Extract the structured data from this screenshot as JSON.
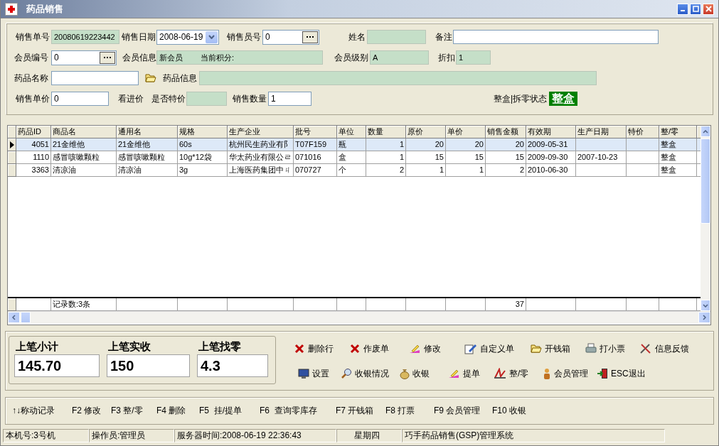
{
  "window": {
    "title": "药品销售"
  },
  "form": {
    "rows": [
      [
        {
          "label": "销售单号",
          "kind": "readonly",
          "value": "20080619223442"
        },
        {
          "label": "销售日期",
          "kind": "date",
          "value": "2008-06-19"
        },
        {
          "label": "销售员号",
          "kind": "lookup",
          "value": "0"
        },
        {
          "label": "姓名",
          "kind": "readonly"
        },
        {
          "label": "备注",
          "kind": "input"
        }
      ],
      [
        {
          "label": "会员编号",
          "kind": "lookup",
          "value": "0"
        },
        {
          "label": "会员信息",
          "kind": "readonly",
          "value": "新会员　　 当前积分:"
        },
        {
          "label": "会员级别",
          "kind": "readonly",
          "value": "A"
        },
        {
          "label": "折扣",
          "kind": "readonly",
          "value": "1"
        }
      ],
      [
        {
          "label": "药品名称",
          "kind": "input"
        },
        {
          "kind": "browse"
        },
        {
          "label": "药品信息",
          "kind": "readonly"
        }
      ],
      [
        {
          "label": "销售单价",
          "kind": "input",
          "value": "0"
        },
        {
          "label": "看进价",
          "kind": "text"
        },
        {
          "label": "是否特价",
          "kind": "readonly"
        },
        {
          "label": "销售数量",
          "kind": "input",
          "value": "1"
        },
        {
          "label": "整盒|拆零状态",
          "kind": "badge",
          "text": "整盒"
        }
      ]
    ]
  },
  "grid": {
    "columns": [
      "药品ID",
      "商品名",
      "通用名",
      "规格",
      "生产企业",
      "批号",
      "单位",
      "数量",
      "原价",
      "单价",
      "销售金额",
      "有效期",
      "生产日期",
      "特价",
      "整/零"
    ],
    "rows": [
      {
        "selected": true,
        "cells": [
          "4051",
          "21金维他",
          "21金维他",
          "60s",
          "杭州民生药业有阝",
          "T07F159",
          "瓶",
          "1",
          "20",
          "20",
          "20",
          "2009-05-31",
          null,
          null,
          "整盒"
        ]
      },
      {
        "selected": false,
        "cells": [
          "1110",
          "感冒咳嗽颗粒",
          "感冒咳嗽颗粒",
          "10g*12袋",
          "华太药业有限公ㄹ",
          "071016",
          "盒",
          "1",
          "15",
          "15",
          "15",
          "2009-09-30",
          "2007-10-23",
          null,
          "整盒"
        ]
      },
      {
        "selected": false,
        "cells": [
          "3363",
          "清凉油",
          "清凉油",
          "3g",
          "上海医药集团中ㄐ",
          "070727",
          "个",
          "2",
          "1",
          "1",
          "2",
          "2010-06-30",
          null,
          null,
          "整盒"
        ]
      }
    ],
    "footer": {
      "count": "记录数:3条",
      "total": "37"
    }
  },
  "totals": [
    {
      "label": "上笔小计",
      "value": "145.70"
    },
    {
      "label": "上笔实收",
      "value": "150"
    },
    {
      "label": "上笔找零",
      "value": "4.3"
    }
  ],
  "actions": [
    [
      "删除行",
      "作废单",
      "修改",
      "自定义单",
      "开钱箱",
      "打小票",
      "信息反馈"
    ],
    [
      "设置",
      "收银情况",
      "收银",
      "提单",
      "整/零",
      "会员管理",
      "ESC退出"
    ]
  ],
  "shortcuts": [
    "↑↓称动记录",
    "F2 修改",
    "F3 整/零",
    "F4 删除",
    "F5  挂/提单",
    "F6  查询零库存",
    "F7 开钱箱",
    "F8 打票",
    "F9 会员管理",
    "F10 收银"
  ],
  "status_bar": [
    "本机号:3号机",
    "操作员:管理员",
    "服务器时间:2008-06-19 22:36:43",
    "星期四",
    "巧手药品销售(GSP)管理系统"
  ]
}
